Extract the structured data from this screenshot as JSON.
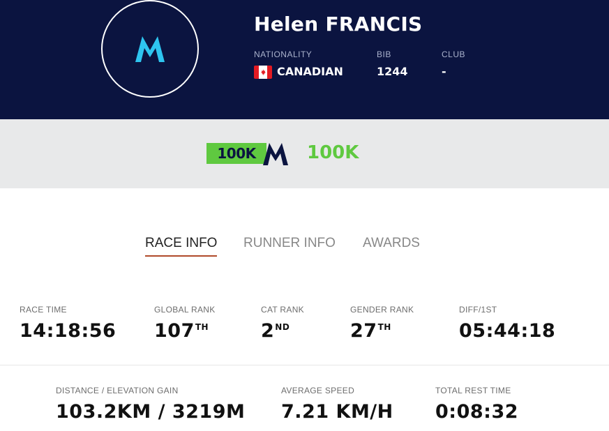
{
  "runner": {
    "name": "Helen FRANCIS",
    "nationality_label": "NATIONALITY",
    "nationality": "CANADIAN",
    "bib_label": "BIB",
    "bib": "1244",
    "club_label": "CLUB",
    "club": "-"
  },
  "race": {
    "logo_text": "100K",
    "title": "100K"
  },
  "tabs": [
    {
      "label": "RACE INFO",
      "active": true
    },
    {
      "label": "RUNNER INFO",
      "active": false
    },
    {
      "label": "AWARDS",
      "active": false
    }
  ],
  "stats_row1": [
    {
      "label": "RACE TIME",
      "value": "14:18:56",
      "suffix": ""
    },
    {
      "label": "GLOBAL RANK",
      "value": "107",
      "suffix": "TH"
    },
    {
      "label": "CAT RANK",
      "value": "2",
      "suffix": "ND"
    },
    {
      "label": "GENDER RANK",
      "value": "27",
      "suffix": "TH"
    },
    {
      "label": "DIFF/1ST",
      "value": "05:44:18",
      "suffix": ""
    }
  ],
  "stats_row2": [
    {
      "label": "DISTANCE / ELEVATION GAIN",
      "value": "103.2KM / 3219M"
    },
    {
      "label": "AVERAGE SPEED",
      "value": "7.21 KM/H"
    },
    {
      "label": "TOTAL REST TIME",
      "value": "0:08:32"
    }
  ],
  "colors": {
    "header_bg": "#0b1440",
    "accent_cyan": "#2ec5f0",
    "race_green": "#5fc940",
    "tab_underline": "#b04a2a"
  },
  "icons": {
    "avatar_logo": "m-logo-icon",
    "flag": "canada-flag-icon",
    "race_logo": "m-race-logo-icon"
  }
}
